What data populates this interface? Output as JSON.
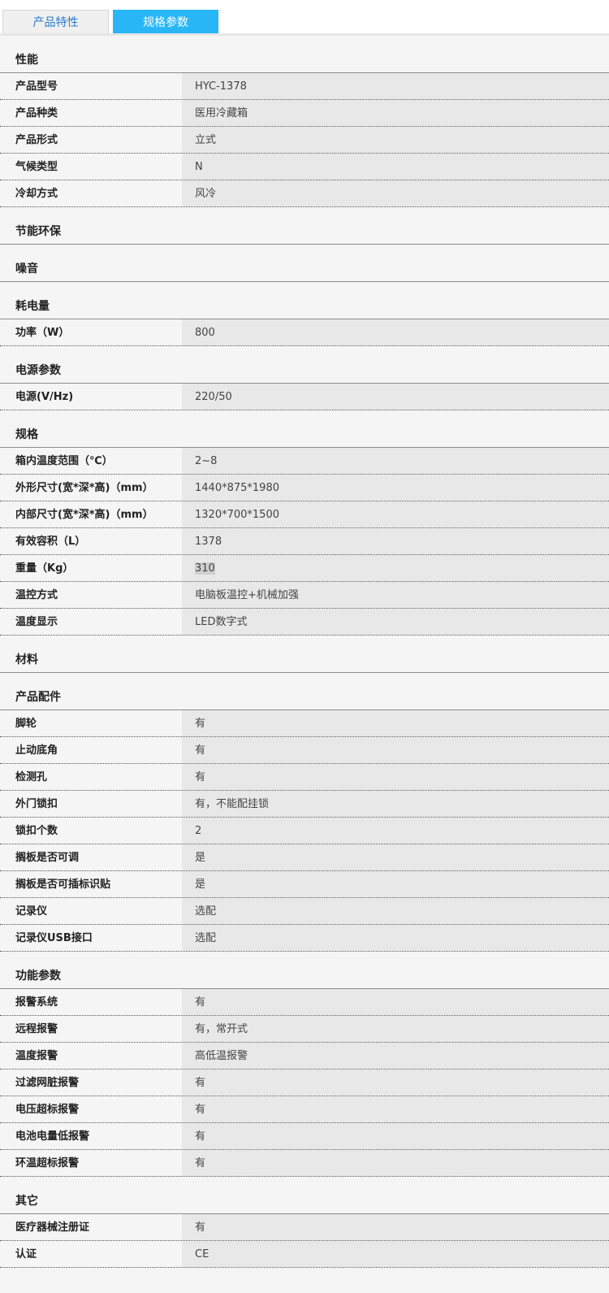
{
  "tabs": [
    {
      "label": "产品特性",
      "active": false
    },
    {
      "label": "规格参数",
      "active": true
    }
  ],
  "colors": {
    "active_tab": "#29b6f6",
    "inactive_tab_text": "#2a7ac8"
  },
  "sections": [
    {
      "title": "性能",
      "rows": [
        {
          "k": "产品型号",
          "v": "HYC-1378"
        },
        {
          "k": "产品种类",
          "v": "医用冷藏箱"
        },
        {
          "k": "产品形式",
          "v": "立式"
        },
        {
          "k": "气候类型",
          "v": "N"
        },
        {
          "k": "冷却方式",
          "v": "风冷"
        }
      ]
    },
    {
      "title": "节能环保",
      "rows": []
    },
    {
      "title": "噪音",
      "rows": []
    },
    {
      "title": "耗电量",
      "rows": [
        {
          "k": "功率（W）",
          "v": "800"
        }
      ]
    },
    {
      "title": "电源参数",
      "rows": [
        {
          "k": "电源(V/Hz)",
          "v": "220/50"
        }
      ]
    },
    {
      "title": "规格",
      "rows": [
        {
          "k": "箱内温度范围（℃）",
          "v": "2~8"
        },
        {
          "k": "外形尺寸(宽*深*高)（mm）",
          "v": "1440*875*1980"
        },
        {
          "k": "内部尺寸(宽*深*高)（mm）",
          "v": "1320*700*1500"
        },
        {
          "k": "有效容积（L）",
          "v": "1378"
        },
        {
          "k": "重量（Kg）",
          "v": "310",
          "highlight": true
        },
        {
          "k": "温控方式",
          "v": "电脑板温控+机械加强"
        },
        {
          "k": "温度显示",
          "v": "LED数字式"
        }
      ]
    },
    {
      "title": "材料",
      "rows": []
    },
    {
      "title": "产品配件",
      "rows": [
        {
          "k": "脚轮",
          "v": "有"
        },
        {
          "k": "止动底角",
          "v": "有"
        },
        {
          "k": "检测孔",
          "v": "有"
        },
        {
          "k": "外门锁扣",
          "v": "有，不能配挂锁"
        },
        {
          "k": "锁扣个数",
          "v": "2"
        },
        {
          "k": "搁板是否可调",
          "v": "是"
        },
        {
          "k": "搁板是否可插标识贴",
          "v": "是"
        },
        {
          "k": "记录仪",
          "v": "选配"
        },
        {
          "k": "记录仪USB接口",
          "v": "选配"
        }
      ]
    },
    {
      "title": "功能参数",
      "rows": [
        {
          "k": "报警系统",
          "v": "有"
        },
        {
          "k": "远程报警",
          "v": "有，常开式"
        },
        {
          "k": "温度报警",
          "v": "高低温报警"
        },
        {
          "k": "过滤网脏报警",
          "v": "有"
        },
        {
          "k": "电压超标报警",
          "v": "有"
        },
        {
          "k": "电池电量低报警",
          "v": "有"
        },
        {
          "k": "环温超标报警",
          "v": "有"
        }
      ]
    },
    {
      "title": "其它",
      "rows": [
        {
          "k": "医疗器械注册证",
          "v": "有"
        },
        {
          "k": "认证",
          "v": "CE"
        }
      ]
    }
  ]
}
